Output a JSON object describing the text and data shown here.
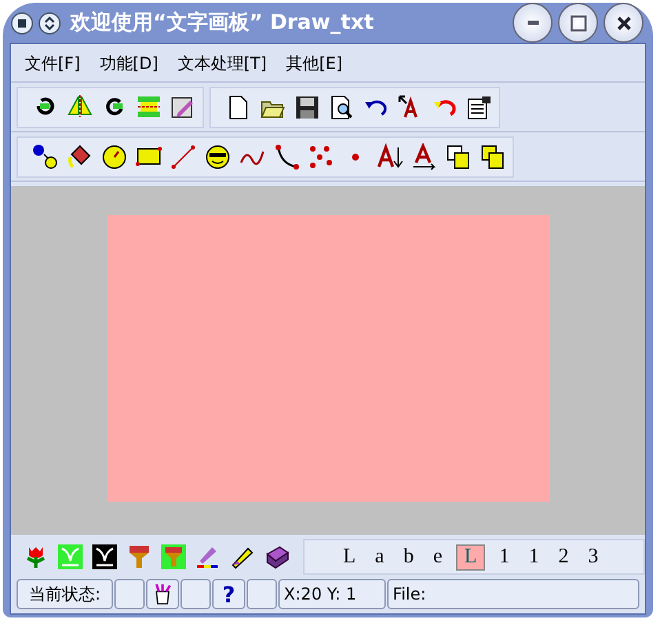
{
  "window": {
    "title": "欢迎使用“文字画板” Draw_txt"
  },
  "menu": [
    {
      "label": "文件",
      "key": "[F]"
    },
    {
      "label": "功能",
      "key": "[D]"
    },
    {
      "label": "文本处理",
      "key": "[T]"
    },
    {
      "label": "其他",
      "key": "[E]"
    }
  ],
  "label_strip": [
    {
      "text": "L",
      "selected": false
    },
    {
      "text": "a",
      "selected": false
    },
    {
      "text": "b",
      "selected": false
    },
    {
      "text": "e",
      "selected": false
    },
    {
      "text": "L",
      "selected": true
    },
    {
      "text": "1",
      "selected": false
    },
    {
      "text": "1",
      "selected": false
    },
    {
      "text": "2",
      "selected": false
    },
    {
      "text": "3",
      "selected": false
    }
  ],
  "status_bar": [
    {
      "kind": "text",
      "text": "当前状态:"
    },
    {
      "kind": "empty"
    },
    {
      "kind": "icon"
    },
    {
      "kind": "empty"
    },
    {
      "kind": "help",
      "text": "?"
    },
    {
      "kind": "empty"
    },
    {
      "kind": "coords",
      "text": "X:20 Y: 1"
    },
    {
      "kind": "file",
      "text": "File:"
    }
  ]
}
